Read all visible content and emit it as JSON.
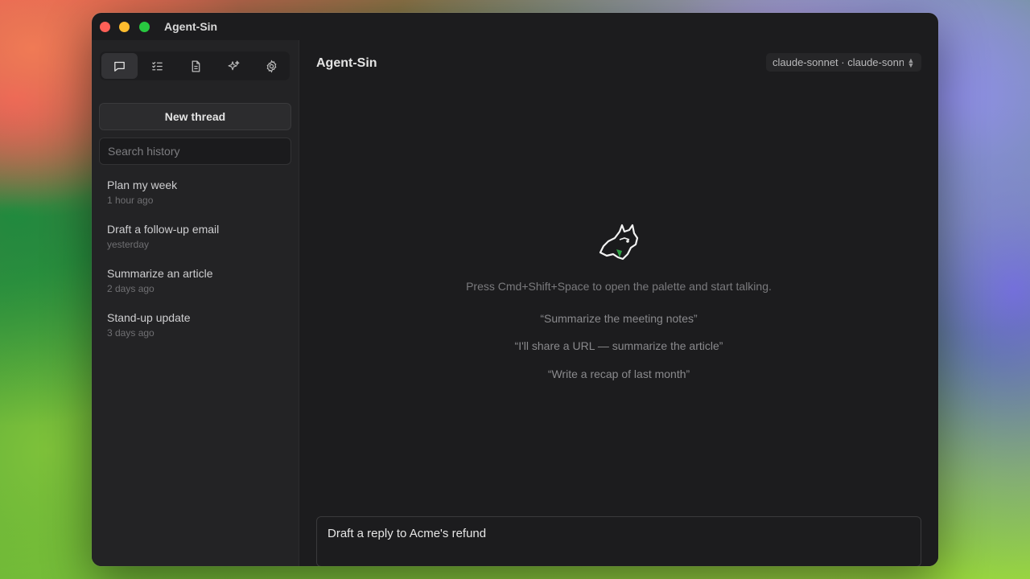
{
  "window": {
    "title": "Agent-Sin"
  },
  "sidebar": {
    "tabs": [
      {
        "icon": "chat-bubble-icon",
        "active": true
      },
      {
        "icon": "checklist-icon",
        "active": false
      },
      {
        "icon": "document-icon",
        "active": false
      },
      {
        "icon": "sparkles-icon",
        "active": false
      },
      {
        "icon": "gear-icon",
        "active": false
      }
    ],
    "new_thread_label": "New thread",
    "search_placeholder": "Search history",
    "history": [
      {
        "title": "Plan my week",
        "time": "1 hour ago"
      },
      {
        "title": "Draft a follow-up email",
        "time": "yesterday"
      },
      {
        "title": "Summarize an article",
        "time": "2 days ago"
      },
      {
        "title": "Stand-up update",
        "time": "3 days ago"
      }
    ]
  },
  "main": {
    "title": "Agent-Sin",
    "model_selector": "claude-sonnet · claude-sonnet",
    "hint": "Press Cmd+Shift+Space to open the palette and start talking.",
    "suggestions": [
      "“Summarize the meeting notes”",
      "“I'll share a URL — summarize the article”",
      "“Write a recap of last month”"
    ],
    "composer_value": "Draft a reply to Acme's refund"
  },
  "colors": {
    "window_bg": "#1c1c1e",
    "sidebar_bg": "#232325",
    "traffic_close": "#fe5f57",
    "traffic_minimize": "#febc2e",
    "traffic_maximize": "#28c840",
    "mascot_accent": "#2ea043"
  }
}
